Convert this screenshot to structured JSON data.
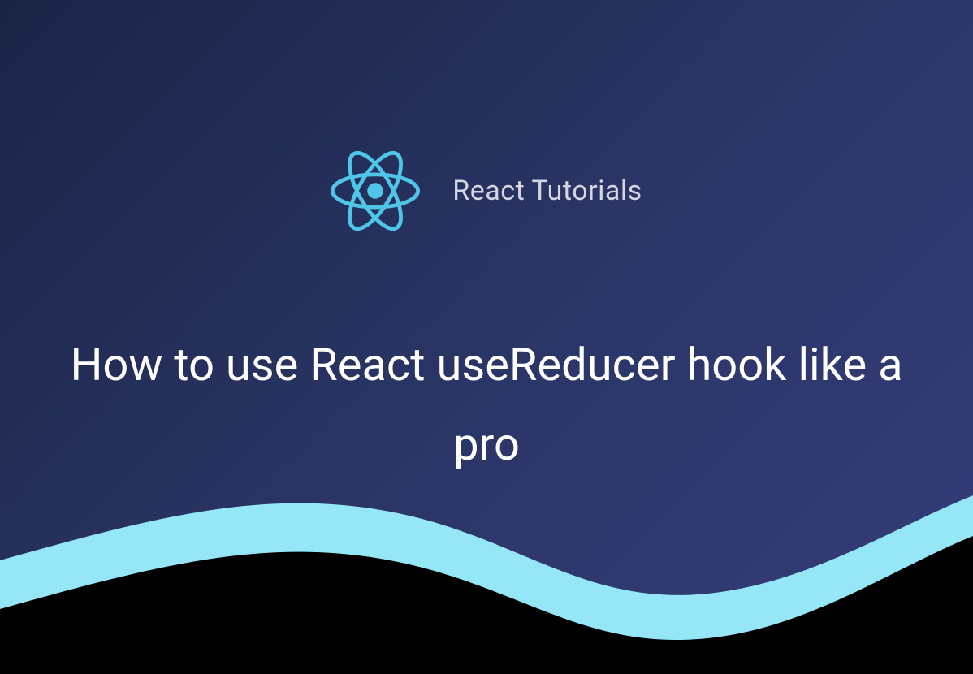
{
  "header": {
    "brand": "React Tutorials",
    "logo_name": "react-logo"
  },
  "main": {
    "title": "How to use React useReducer hook like a pro"
  },
  "colors": {
    "accent_light": "#95e7f7",
    "accent_dark": "#000000",
    "logo": "#4fc5e8",
    "text_primary": "#ffffff",
    "text_secondary": "#d4d7e0"
  }
}
